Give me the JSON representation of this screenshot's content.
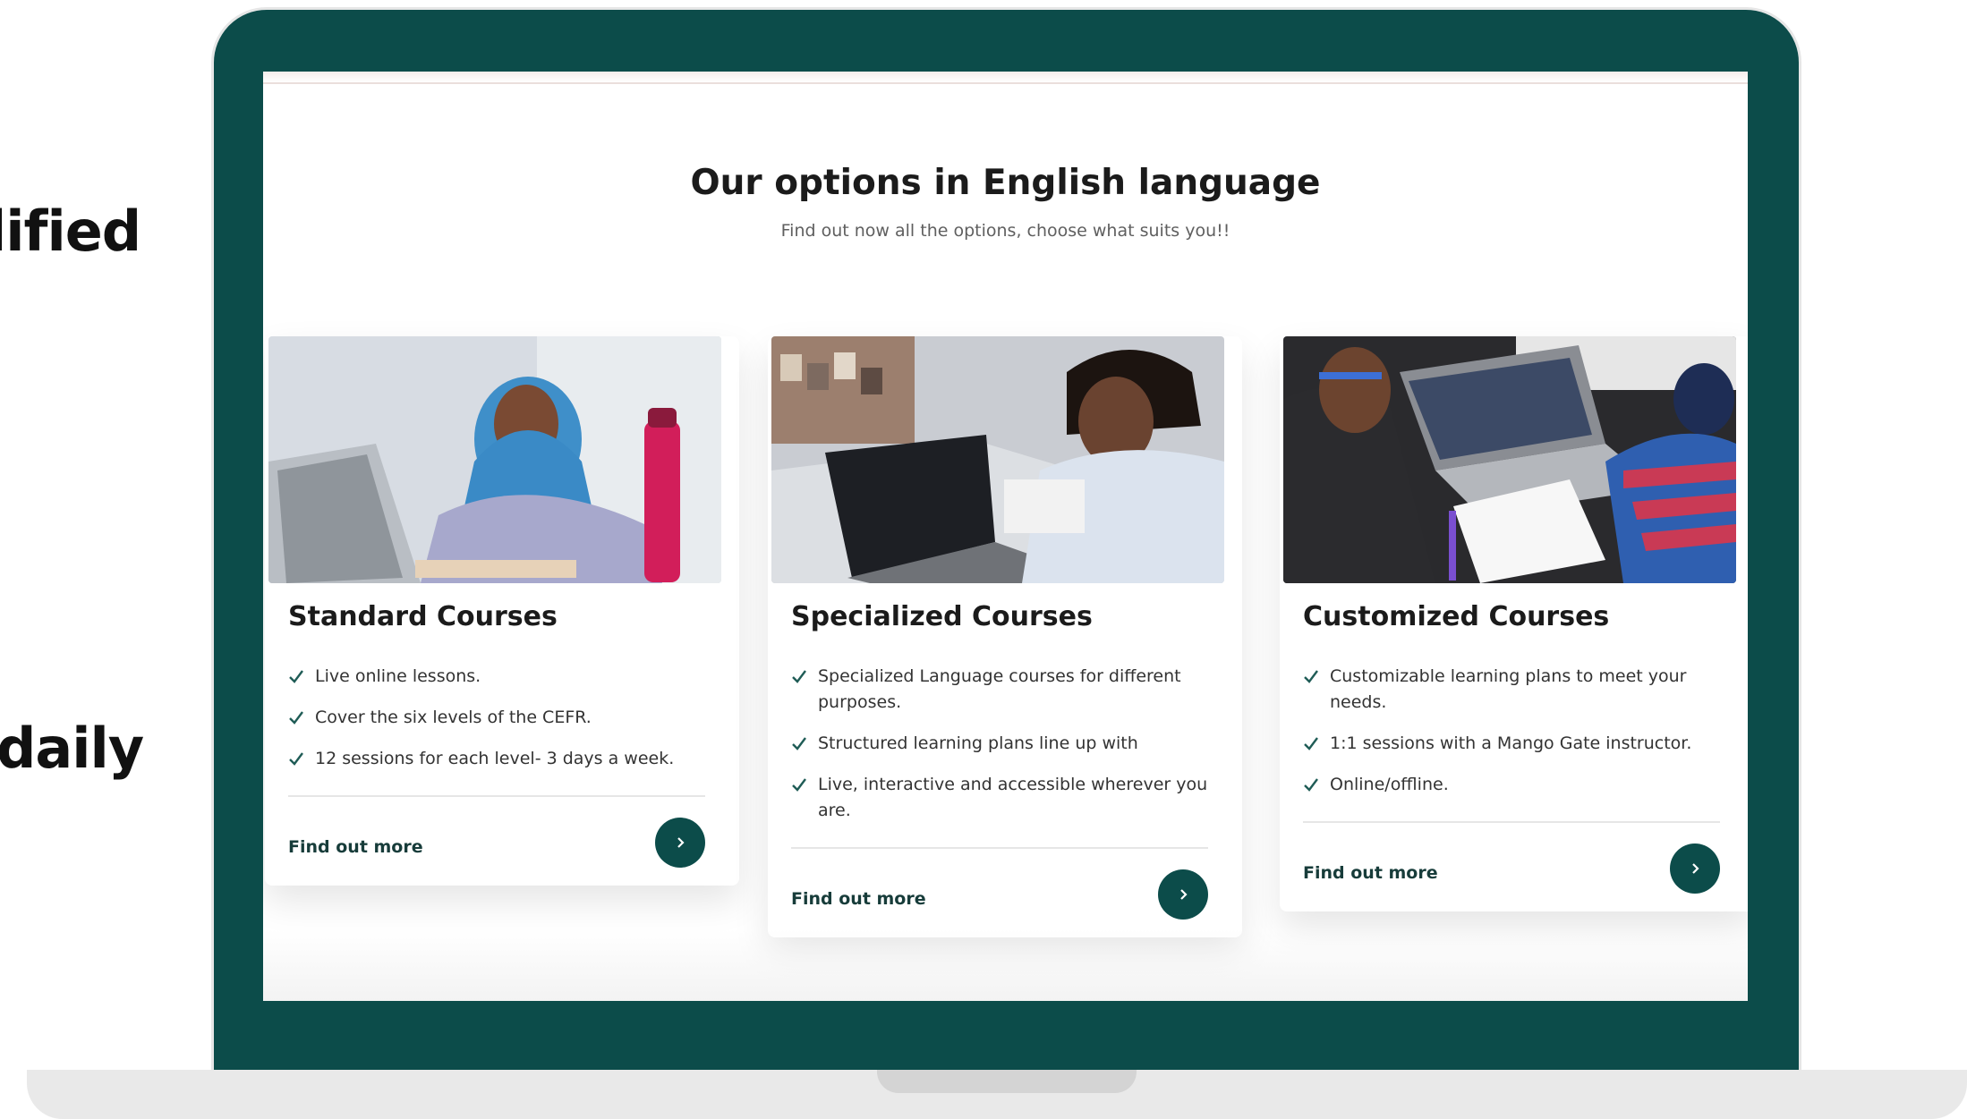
{
  "side_text": {
    "upper": "lified",
    "lower": "daily"
  },
  "page": {
    "heading": "Our options in English language",
    "subheading": "Find out now all the options, choose what suits you!!"
  },
  "cards": [
    {
      "title": "Standard Courses",
      "features": [
        "Live online lessons.",
        "Cover the six levels of the CEFR.",
        "12 sessions for each level- 3 days a week."
      ],
      "cta": "Find out more"
    },
    {
      "title": "Specialized Courses",
      "features": [
        "Specialized Language courses for different purposes.",
        "Structured learning plans line up with",
        "Live, interactive and accessible wherever you are."
      ],
      "cta": "Find out more"
    },
    {
      "title": "Customized Courses",
      "features": [
        "Customizable learning plans to meet your needs.",
        "1:1 sessions with a Mango Gate instructor.",
        "Online/offline."
      ],
      "cta": "Find out more"
    }
  ],
  "icons": {
    "feature": "check-icon",
    "button": "chevron-right-icon"
  },
  "colors": {
    "brand": "#0c4c4a",
    "check": "#1f5c56",
    "text": "#1b1b1b"
  }
}
